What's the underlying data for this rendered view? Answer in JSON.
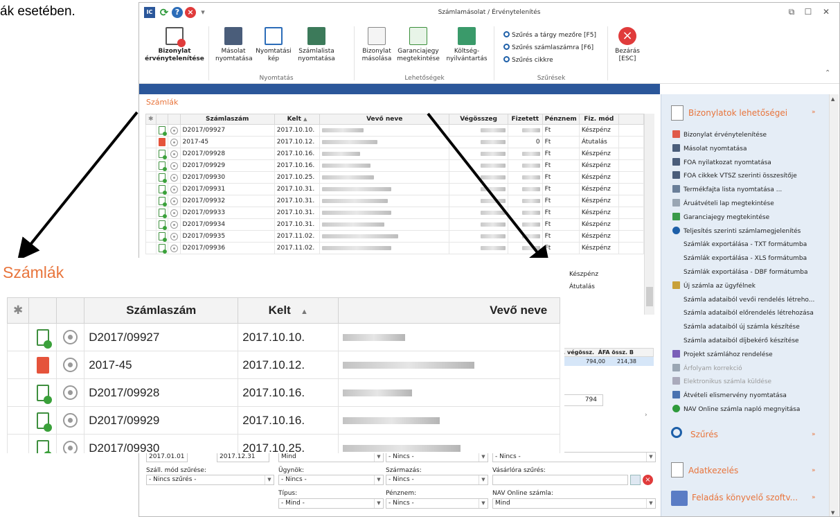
{
  "caption": "ák esetében.",
  "window": {
    "title": "Számlamásolat / Érvénytelenítés",
    "quick_access": [
      "app-icon",
      "refresh-icon",
      "help-icon",
      "close-red-icon",
      "dropdown-icon"
    ]
  },
  "ribbon": {
    "buttons": {
      "invalidate": "Bizonylat érvénytelenítése",
      "copy_print": "Másolat nyomtatása",
      "print_preview": "Nyomtatási kép",
      "list_print": "Számlalista nyomtatása",
      "doc_copy": "Bizonylat másolása",
      "warranty": "Garanciajegy megtekintése",
      "cost": "Költség-nyilvántartás",
      "close": "Bezárás [ESC]"
    },
    "groups": {
      "print": "Nyomtatás",
      "options": "Lehetőségek",
      "filters": "Szűrések"
    },
    "search": [
      "Szűrés a tárgy mezőre [F5]",
      "Szűrés számlaszámra [F6]",
      "Szűrés cikkre"
    ]
  },
  "grid": {
    "title": "Számlák",
    "columns": [
      "Számlaszám",
      "Kelt",
      "Vevő neve",
      "Végösszeg",
      "Fizetett",
      "Pénznem",
      "Fiz. mód"
    ],
    "rows": [
      {
        "icon": "ok",
        "number": "D2017/09927",
        "date": "2017.10.10.",
        "paid": "",
        "currency": "Ft",
        "method": "Készpénz"
      },
      {
        "icon": "red",
        "number": "2017-45",
        "date": "2017.10.12.",
        "paid": "0",
        "currency": "Ft",
        "method": "Átutalás"
      },
      {
        "icon": "ok",
        "number": "D2017/09928",
        "date": "2017.10.16.",
        "paid": "",
        "currency": "Ft",
        "method": "Készpénz"
      },
      {
        "icon": "ok",
        "number": "D2017/09929",
        "date": "2017.10.16.",
        "paid": "",
        "currency": "Ft",
        "method": "Készpénz"
      },
      {
        "icon": "ok",
        "number": "D2017/09930",
        "date": "2017.10.25.",
        "paid": "",
        "currency": "Ft",
        "method": "Készpénz"
      },
      {
        "icon": "ok",
        "number": "D2017/09931",
        "date": "2017.10.31.",
        "paid": "",
        "currency": "Ft",
        "method": "Készpénz"
      },
      {
        "icon": "ok",
        "number": "D2017/09932",
        "date": "2017.10.31.",
        "paid": "",
        "currency": "Ft",
        "method": "Készpénz"
      },
      {
        "icon": "ok",
        "number": "D2017/09933",
        "date": "2017.10.31.",
        "paid": "",
        "currency": "Ft",
        "method": "Készpénz"
      },
      {
        "icon": "ok",
        "number": "D2017/09934",
        "date": "2017.10.31.",
        "paid": "",
        "currency": "Ft",
        "method": "Készpénz"
      },
      {
        "icon": "ok",
        "number": "D2017/09935",
        "date": "2017.11.02.",
        "paid": "",
        "currency": "Ft",
        "method": "Készpénz"
      },
      {
        "icon": "ok",
        "number": "D2017/09936",
        "date": "2017.11.02.",
        "paid": "",
        "currency": "Ft",
        "method": "Készpénz"
      }
    ],
    "extra_methods": [
      "Készpénz",
      "Átutalás"
    ]
  },
  "detail": {
    "col_total": "le. végössz.",
    "col_vat": "ÁFA össz.",
    "col_b": "B",
    "total": "794,00",
    "vat": "214,38",
    "sum": "794"
  },
  "filters": {
    "date_from": "2017.01.01",
    "date_to": "2017.12.31",
    "row1": [
      "Mind",
      "- Nincs -",
      "- Nincs -"
    ],
    "labels": {
      "shipping": "Száll. mód szűrése:",
      "agent": "Ügynök:",
      "origin": "Származás:",
      "buyer": "Vásárlóra szűrés:",
      "type": "Típus:",
      "currency": "Pénznem:",
      "nav": "NAV Online számla:"
    },
    "values": {
      "shipping": "- Nincs szűrés -",
      "agent": "- Nincs -",
      "origin": "- Nincs -",
      "buyer": "",
      "type": "- Mind -",
      "currency": "- Nincs -",
      "nav": "Mind"
    }
  },
  "panel": {
    "title": "Bizonylatok lehetőségei",
    "items": [
      {
        "label": "Bizonylat érvénytelenítése",
        "icon": "doc-x-icon",
        "enabled": true
      },
      {
        "label": "Másolat nyomtatása",
        "icon": "printer-icon",
        "enabled": true
      },
      {
        "label": "FOA nyilatkozat nyomtatása",
        "icon": "printer-icon",
        "enabled": true
      },
      {
        "label": "FOA cikkek VTSZ szerinti összesítője",
        "icon": "printer-icon",
        "enabled": true
      },
      {
        "label": "Termékfajta lista nyomtatása ...",
        "icon": "list-icon",
        "enabled": true
      },
      {
        "label": "Áruátvételi lap megtekintése",
        "icon": "copy-icon",
        "enabled": true
      },
      {
        "label": "Garanciajegy megtekintése",
        "icon": "warranty-icon",
        "enabled": true
      },
      {
        "label": "Teljesítés szerinti számlamegjelenítés",
        "icon": "search-icon",
        "enabled": true
      },
      {
        "label": "Számlák exportálása - TXT formátumba",
        "icon": "",
        "enabled": true
      },
      {
        "label": "Számlák exportálása - XLS formátumba",
        "icon": "",
        "enabled": true
      },
      {
        "label": "Számlák exportálása - DBF formátumba",
        "icon": "",
        "enabled": true
      },
      {
        "label": "Új számla az ügyfélnek",
        "icon": "new-doc-icon",
        "enabled": true
      },
      {
        "label": "Számla adataiból vevői rendelés létreho...",
        "icon": "",
        "enabled": true
      },
      {
        "label": "Számla adataiból előrendelés létrehozása",
        "icon": "",
        "enabled": true
      },
      {
        "label": "Számla adataiból új számla készítése",
        "icon": "",
        "enabled": true
      },
      {
        "label": "Számla adataiból díjbekérő készítése",
        "icon": "",
        "enabled": true
      },
      {
        "label": "Projekt számlához rendelése",
        "icon": "project-icon",
        "enabled": true
      },
      {
        "label": "Árfolyam korrekció",
        "icon": "copy-icon",
        "enabled": false
      },
      {
        "label": "Elektronikus számla küldése",
        "icon": "email-icon",
        "enabled": false
      },
      {
        "label": "Átvételi elismervény nyomtatása",
        "icon": "receipt-icon",
        "enabled": true
      },
      {
        "label": "NAV Online számla napló megnyitása",
        "icon": "nav-icon",
        "enabled": true
      }
    ],
    "sections": [
      "Szűrés",
      "Adatkezelés",
      "Feladás könyvelő szoftv..."
    ]
  },
  "zoom": {
    "title": "Számlák",
    "columns": [
      "Számlaszám",
      "Kelt",
      "Vevő neve"
    ],
    "rows": [
      {
        "icon": "ok",
        "number": "D2017/09927",
        "date": "2017.10.10."
      },
      {
        "icon": "red",
        "number": "2017-45",
        "date": "2017.10.12."
      },
      {
        "icon": "ok",
        "number": "D2017/09928",
        "date": "2017.10.16."
      },
      {
        "icon": "ok",
        "number": "D2017/09929",
        "date": "2017.10.16."
      },
      {
        "icon": "ok",
        "number": "D2017/09930",
        "date": "2017.10.25."
      }
    ]
  }
}
